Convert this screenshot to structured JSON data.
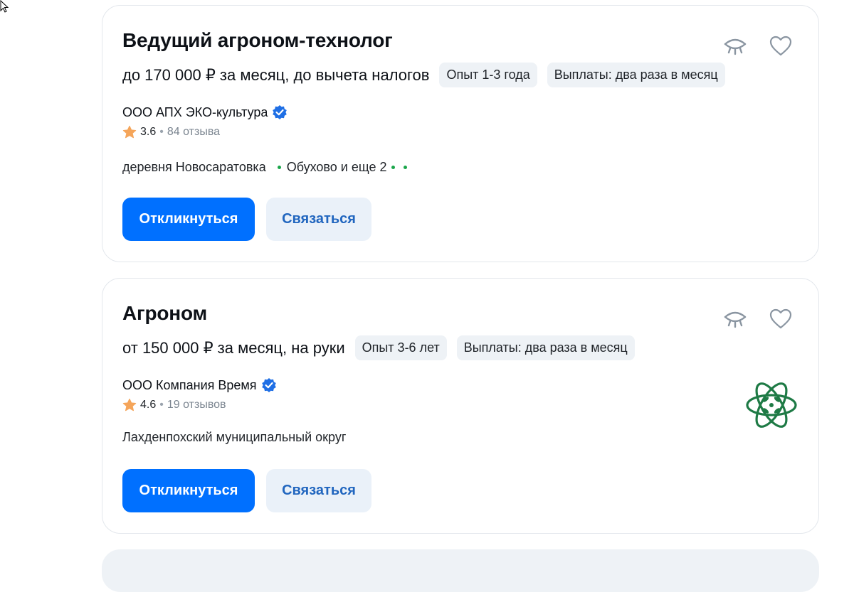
{
  "vacancies": [
    {
      "title": "Ведущий агроном-технолог",
      "salary": "до 170 000 ₽ за месяц, до вычета налогов",
      "tags": [
        "Опыт 1-3 года",
        "Выплаты: два раза в месяц"
      ],
      "company": "ООО АПХ ЭКО-культура",
      "verified": true,
      "rating": "3.6",
      "reviews": "84 отзыва",
      "location": "деревня Новосаратовка",
      "metro": "Обухово и еще 2",
      "respond_label": "Откликнуться",
      "contact_label": "Связаться",
      "has_logo": false
    },
    {
      "title": "Агроном",
      "salary": "от 150 000 ₽ за месяц, на руки",
      "tags": [
        "Опыт 3-6 лет",
        "Выплаты: два раза в месяц"
      ],
      "company": "ООО Компания Время",
      "verified": true,
      "rating": "4.6",
      "reviews": "19 отзывов",
      "location": "Лахденпохский муниципальный округ",
      "respond_label": "Откликнуться",
      "contact_label": "Связаться",
      "has_logo": true
    }
  ],
  "icons": {
    "hide": "eye-closed-icon",
    "favorite": "heart-icon",
    "verified": "verified-badge-icon",
    "rating": "star-icon",
    "cursor": "mouse-cursor-icon"
  },
  "colors": {
    "primary_button": "#0070ff",
    "secondary_button_bg": "#eaf1f9",
    "secondary_button_text": "#2166bf",
    "chip_bg": "#eef2f6",
    "star": "#f5a55a",
    "verified": "#1f6fe5",
    "metro_dot": "#1aa64a",
    "logo": "#1e7a45"
  }
}
